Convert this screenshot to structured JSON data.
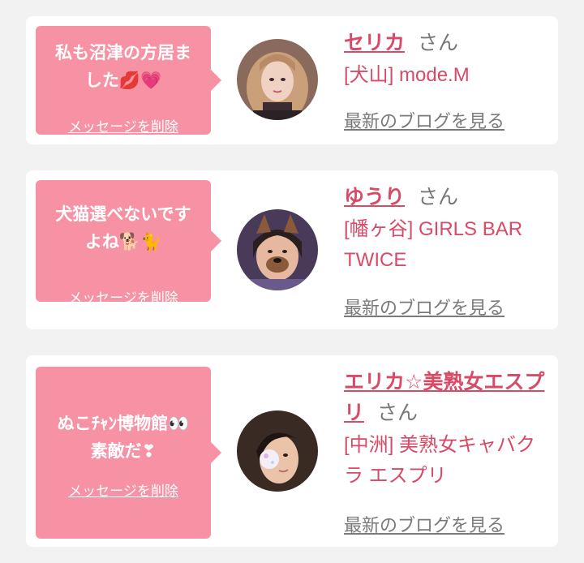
{
  "messages": [
    {
      "message": "私も沼津の方居ま\nした💋💗",
      "delete_label": "メッセージを削除",
      "name": "セリカ",
      "honorific": "さん",
      "shop": "[犬山] mode.M",
      "blog_label": "最新のブログを見る"
    },
    {
      "message": "犬猫選べないです\nよね🐕🐈",
      "delete_label": "メッセージを削除",
      "name": "ゆうり",
      "honorific": "さん",
      "shop": "[幡ヶ谷] GIRLS BAR TWICE",
      "blog_label": "最新のブログを見る"
    },
    {
      "message": "ぬこﾁｬﾝ博物館👀\n素敵だ❣",
      "delete_label": "メッセージを削除",
      "name": "エリカ☆美熟女エスプリ",
      "honorific": "さん",
      "shop": "[中洲] 美熟女キャバクラ エスプリ",
      "blog_label": "最新のブログを見る"
    }
  ],
  "colors": {
    "background": "#f2f2f2",
    "card": "#ffffff",
    "bubble": "#f791a4",
    "accent": "#d84a66",
    "muted": "#7a7a7a"
  }
}
